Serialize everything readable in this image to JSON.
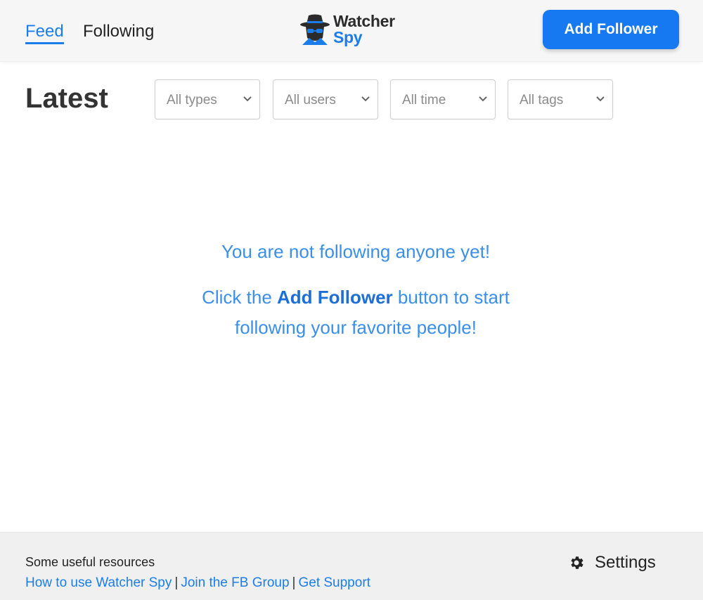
{
  "header": {
    "nav": [
      {
        "label": "Feed",
        "active": true
      },
      {
        "label": "Following",
        "active": false
      }
    ],
    "logo": {
      "word1": "Watcher",
      "word2": "Spy",
      "icon": "spy-icon"
    },
    "add_button_label": "Add Follower"
  },
  "main": {
    "title": "Latest",
    "filters": [
      {
        "value": "All types"
      },
      {
        "value": "All users"
      },
      {
        "value": "All time"
      },
      {
        "value": "All tags"
      }
    ],
    "empty_state": {
      "line1": "You are not following anyone yet!",
      "line2_pre": "Click the ",
      "line2_strong": "Add Follower",
      "line2_post": " button to start following your favorite people!"
    }
  },
  "footer": {
    "resources_title": "Some useful resources",
    "links": [
      {
        "label": "How to use Watcher Spy"
      },
      {
        "label": "Join the FB Group"
      },
      {
        "label": "Get Support"
      }
    ],
    "separator": "|",
    "settings_label": "Settings",
    "settings_icon": "gear-icon"
  },
  "colors": {
    "accent": "#1b7de9",
    "button": "#1679f2",
    "empty_text": "#3c8fe8",
    "header_bg": "#f6f6f6",
    "footer_bg": "#f0f0f0"
  }
}
